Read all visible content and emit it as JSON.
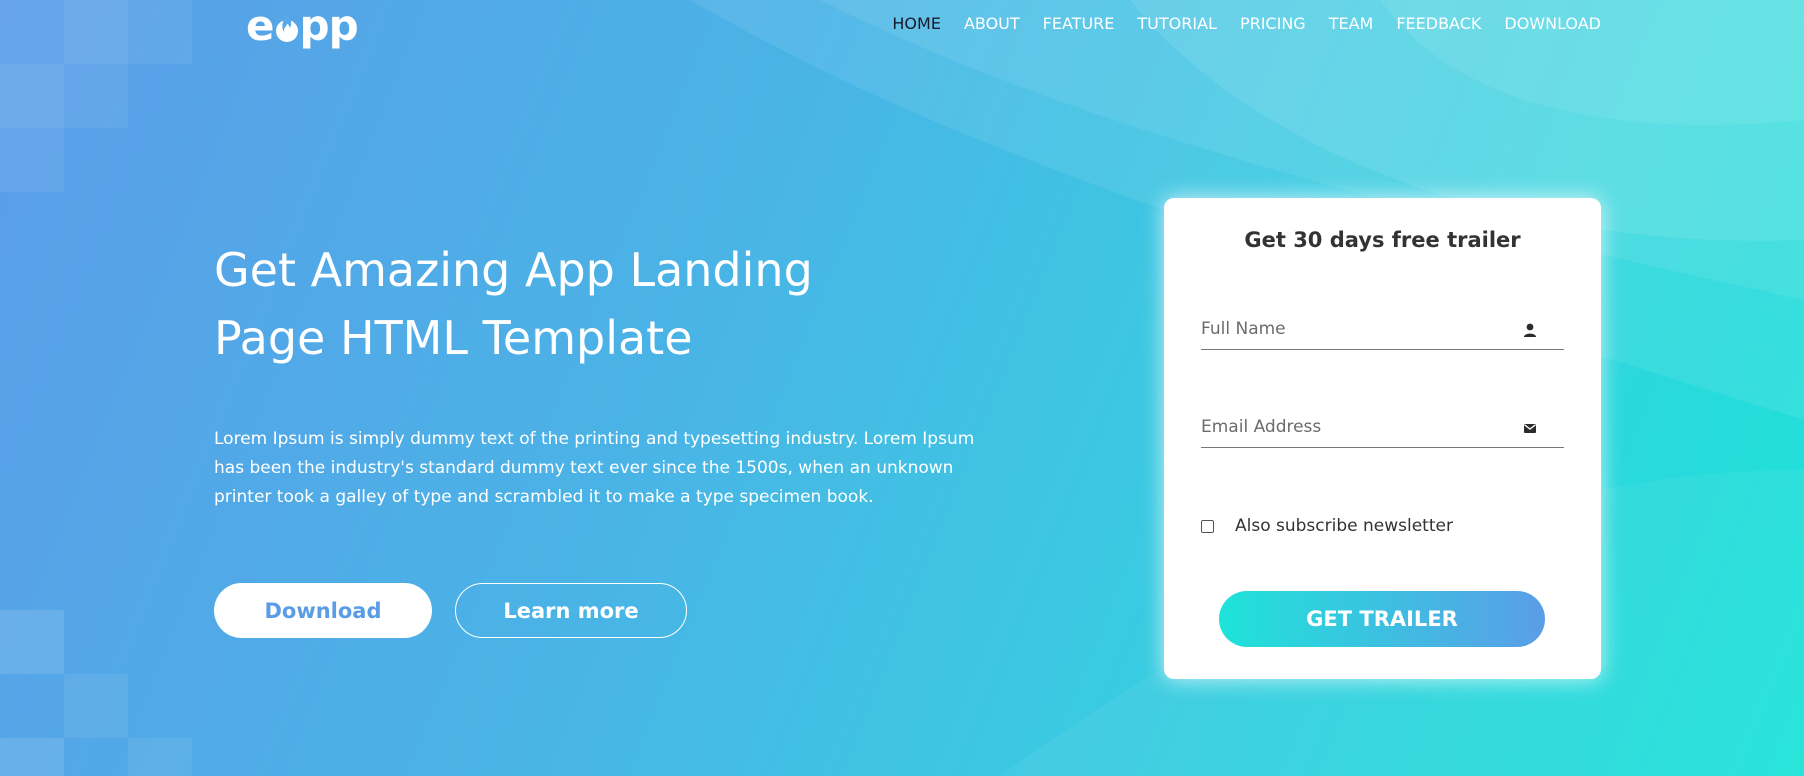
{
  "brand": {
    "logo_text_left": "e",
    "logo_text_right": "pp",
    "logo_icon": "flame-icon"
  },
  "nav": {
    "items": [
      {
        "label": "HOME",
        "active": true
      },
      {
        "label": "ABOUT",
        "active": false
      },
      {
        "label": "FEATURE",
        "active": false
      },
      {
        "label": "TUTORIAL",
        "active": false
      },
      {
        "label": "PRICING",
        "active": false
      },
      {
        "label": "TEAM",
        "active": false
      },
      {
        "label": "FEEDBACK",
        "active": false
      },
      {
        "label": "DOWNLOAD",
        "active": false
      }
    ]
  },
  "hero": {
    "title_line1": "Get Amazing App Landing",
    "title_line2": "Page HTML Template",
    "description": "Lorem Ipsum is simply dummy text of the printing and typesetting industry. Lorem Ipsum has been the industry's standard dummy text ever since the 1500s, when an unknown printer took a galley of type and scrambled it to make a type specimen book.",
    "download_label": "Download",
    "learn_more_label": "Learn more"
  },
  "signup": {
    "title": "Get 30 days free trailer",
    "full_name_placeholder": "Full Name",
    "full_name_icon": "user-icon",
    "email_placeholder": "Email Address",
    "email_icon": "envelope-icon",
    "newsletter_label": "Also subscribe newsletter",
    "newsletter_checked": false,
    "submit_label": "GET TRAILER"
  },
  "colors": {
    "gradient_start": "#5b9de8",
    "gradient_end": "#1ee3d9",
    "nav_active": "#1a1a2e",
    "download_text": "#5a9ce6"
  }
}
